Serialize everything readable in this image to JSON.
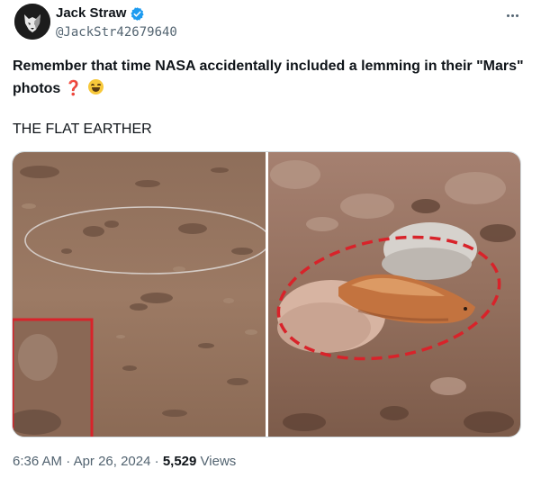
{
  "author": {
    "display_name": "Jack Straw",
    "handle": "@JackStr42679640",
    "verified": true,
    "avatar_icon": "wolf-head-icon"
  },
  "more_icon": "more-dots-icon",
  "post": {
    "text": "Remember that time NASA accidentally included a lemming in their \"Mars\" photos",
    "emoji_1": "❓",
    "emoji_2": "laughing-face-emoji",
    "subtext": "THE FLAT EARTHER"
  },
  "media": {
    "left_photo": "mars-terrain-with-circle-and-red-inset",
    "right_photo": "zoomed-rodent-circled-in-red-dashes"
  },
  "meta": {
    "time": "6:36 AM",
    "separator": "·",
    "date": "Apr 26, 2024",
    "views_count": "5,529",
    "views_label": "Views"
  },
  "colors": {
    "text_primary": "#0f1419",
    "text_secondary": "#536471",
    "verified_blue": "#1d9bf0",
    "annotation_red": "#d8232a"
  }
}
